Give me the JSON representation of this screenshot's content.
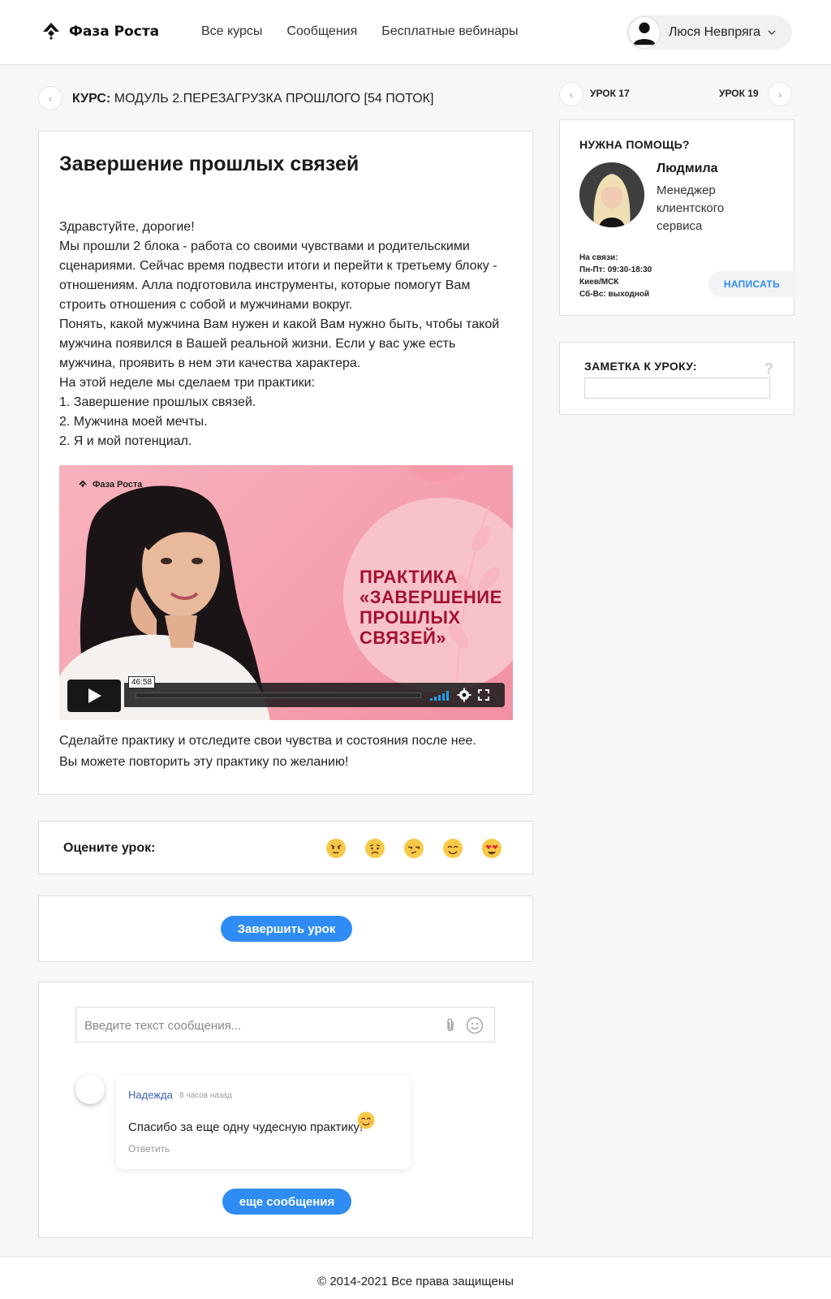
{
  "header": {
    "logo_text": "Фаза Роста",
    "nav": [
      "Все курсы",
      "Сообщения",
      "Бесплатные вебинары"
    ],
    "user_name": "Люся Невпряга"
  },
  "breadcrumb": {
    "prefix": "КУРС:",
    "course": "МОДУЛЬ 2.ПЕРЕЗАГРУЗКА ПРОШЛОГО [54 ПОТОК]"
  },
  "lesson_nav": {
    "prev": "УРОК 17",
    "next": "УРОК 19"
  },
  "lesson": {
    "title": "Завершение прошлых связей",
    "paragraphs": [
      "Здравстуйте, дорогие!",
      "Мы прошли 2 блока - работа со своими чувствами и родительскими сценариями. Сейчас время подвести итоги и перейти к третьему блоку - отношениям. Алла подготовила инструменты, которые помогут Вам строить отношения с собой и мужчинами вокруг.",
      "Понять, какой мужчина Вам нужен и какой Вам нужно быть, чтобы такой мужчина появился в Вашей реальной жизни. Если у вас уже есть мужчина, проявить в нем эти качества характера.",
      "На этой неделе мы сделаем три практики:",
      "1. Завершение прошлых связей.",
      "2. Мужчина моей мечты.",
      "2. Я и мой потенциал."
    ],
    "video": {
      "logo_text": "Фаза Роста",
      "title_lines": [
        "ПРАКТИКА",
        "«ЗАВЕРШЕНИЕ",
        "ПРОШЛЫХ",
        "СВЯЗЕЙ»"
      ],
      "time": "46:58"
    },
    "after_lines": [
      "Сделайте практику и отследите свои чувства и состояния после нее.",
      "Вы можете повторить эту практику по желанию!"
    ]
  },
  "rating": {
    "label": "Оцените урок:",
    "emojis": [
      "angry-emoji",
      "worried-emoji",
      "unamused-emoji",
      "smiling-emoji",
      "heart-eyes-emoji"
    ]
  },
  "finish_button": "Завершить урок",
  "chat": {
    "placeholder": "Введите текст сообщения...",
    "comment": {
      "author": "Надежда",
      "time": "8 часов назад",
      "text": "Спасибо за еще одну чудесную практику!",
      "reply": "Ответить"
    },
    "more_button": "еще сообщения"
  },
  "help": {
    "title": "НУЖНА ПОМОЩЬ?",
    "manager_name": "Людмила",
    "manager_role": "Менеджер клиентского сервиса",
    "contact_lines": [
      "На связи:",
      "Пн-Пт: 09:30-18:30",
      "Киев/МСК",
      "Сб-Вс: выходной"
    ],
    "write_button": "НАПИСАТЬ"
  },
  "note": {
    "title": "ЗАМЕТКА К УРОКУ:",
    "help": "?"
  },
  "footer": "© 2014-2021 Все права защищены",
  "colors": {
    "accent": "#2f8cf5",
    "video_bg": "#f6a6b3",
    "video_title": "#a31233"
  }
}
